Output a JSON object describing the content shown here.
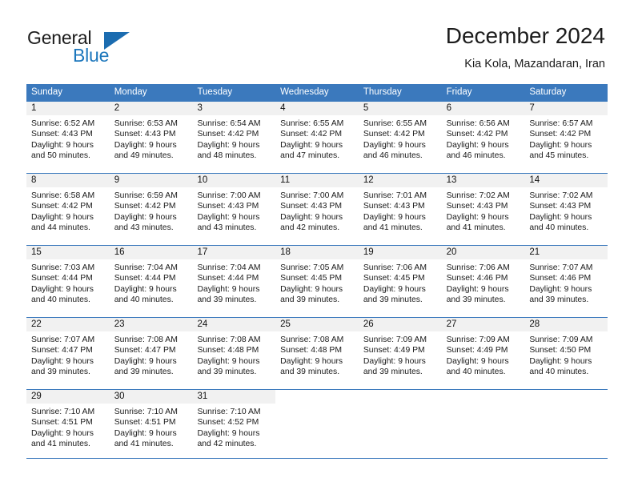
{
  "brand": {
    "name_part1": "General",
    "name_part2": "Blue",
    "flag_icon": "blue-triangle-flag-icon",
    "accent_color": "#1b76bc"
  },
  "header": {
    "month_title": "December 2024",
    "location": "Kia Kola, Mazandaran, Iran"
  },
  "theme": {
    "header_row_bg": "#3b79bd",
    "day_number_band_bg": "#f1f1f1",
    "grid_line": "#3b79bd",
    "text": "#1a1a1a"
  },
  "calendar": {
    "weekday_headers": [
      "Sunday",
      "Monday",
      "Tuesday",
      "Wednesday",
      "Thursday",
      "Friday",
      "Saturday"
    ],
    "weeks": [
      [
        {
          "day": "1",
          "sunrise": "Sunrise: 6:52 AM",
          "sunset": "Sunset: 4:43 PM",
          "daylight_line1": "Daylight: 9 hours",
          "daylight_line2": "and 50 minutes."
        },
        {
          "day": "2",
          "sunrise": "Sunrise: 6:53 AM",
          "sunset": "Sunset: 4:43 PM",
          "daylight_line1": "Daylight: 9 hours",
          "daylight_line2": "and 49 minutes."
        },
        {
          "day": "3",
          "sunrise": "Sunrise: 6:54 AM",
          "sunset": "Sunset: 4:42 PM",
          "daylight_line1": "Daylight: 9 hours",
          "daylight_line2": "and 48 minutes."
        },
        {
          "day": "4",
          "sunrise": "Sunrise: 6:55 AM",
          "sunset": "Sunset: 4:42 PM",
          "daylight_line1": "Daylight: 9 hours",
          "daylight_line2": "and 47 minutes."
        },
        {
          "day": "5",
          "sunrise": "Sunrise: 6:55 AM",
          "sunset": "Sunset: 4:42 PM",
          "daylight_line1": "Daylight: 9 hours",
          "daylight_line2": "and 46 minutes."
        },
        {
          "day": "6",
          "sunrise": "Sunrise: 6:56 AM",
          "sunset": "Sunset: 4:42 PM",
          "daylight_line1": "Daylight: 9 hours",
          "daylight_line2": "and 46 minutes."
        },
        {
          "day": "7",
          "sunrise": "Sunrise: 6:57 AM",
          "sunset": "Sunset: 4:42 PM",
          "daylight_line1": "Daylight: 9 hours",
          "daylight_line2": "and 45 minutes."
        }
      ],
      [
        {
          "day": "8",
          "sunrise": "Sunrise: 6:58 AM",
          "sunset": "Sunset: 4:42 PM",
          "daylight_line1": "Daylight: 9 hours",
          "daylight_line2": "and 44 minutes."
        },
        {
          "day": "9",
          "sunrise": "Sunrise: 6:59 AM",
          "sunset": "Sunset: 4:42 PM",
          "daylight_line1": "Daylight: 9 hours",
          "daylight_line2": "and 43 minutes."
        },
        {
          "day": "10",
          "sunrise": "Sunrise: 7:00 AM",
          "sunset": "Sunset: 4:43 PM",
          "daylight_line1": "Daylight: 9 hours",
          "daylight_line2": "and 43 minutes."
        },
        {
          "day": "11",
          "sunrise": "Sunrise: 7:00 AM",
          "sunset": "Sunset: 4:43 PM",
          "daylight_line1": "Daylight: 9 hours",
          "daylight_line2": "and 42 minutes."
        },
        {
          "day": "12",
          "sunrise": "Sunrise: 7:01 AM",
          "sunset": "Sunset: 4:43 PM",
          "daylight_line1": "Daylight: 9 hours",
          "daylight_line2": "and 41 minutes."
        },
        {
          "day": "13",
          "sunrise": "Sunrise: 7:02 AM",
          "sunset": "Sunset: 4:43 PM",
          "daylight_line1": "Daylight: 9 hours",
          "daylight_line2": "and 41 minutes."
        },
        {
          "day": "14",
          "sunrise": "Sunrise: 7:02 AM",
          "sunset": "Sunset: 4:43 PM",
          "daylight_line1": "Daylight: 9 hours",
          "daylight_line2": "and 40 minutes."
        }
      ],
      [
        {
          "day": "15",
          "sunrise": "Sunrise: 7:03 AM",
          "sunset": "Sunset: 4:44 PM",
          "daylight_line1": "Daylight: 9 hours",
          "daylight_line2": "and 40 minutes."
        },
        {
          "day": "16",
          "sunrise": "Sunrise: 7:04 AM",
          "sunset": "Sunset: 4:44 PM",
          "daylight_line1": "Daylight: 9 hours",
          "daylight_line2": "and 40 minutes."
        },
        {
          "day": "17",
          "sunrise": "Sunrise: 7:04 AM",
          "sunset": "Sunset: 4:44 PM",
          "daylight_line1": "Daylight: 9 hours",
          "daylight_line2": "and 39 minutes."
        },
        {
          "day": "18",
          "sunrise": "Sunrise: 7:05 AM",
          "sunset": "Sunset: 4:45 PM",
          "daylight_line1": "Daylight: 9 hours",
          "daylight_line2": "and 39 minutes."
        },
        {
          "day": "19",
          "sunrise": "Sunrise: 7:06 AM",
          "sunset": "Sunset: 4:45 PM",
          "daylight_line1": "Daylight: 9 hours",
          "daylight_line2": "and 39 minutes."
        },
        {
          "day": "20",
          "sunrise": "Sunrise: 7:06 AM",
          "sunset": "Sunset: 4:46 PM",
          "daylight_line1": "Daylight: 9 hours",
          "daylight_line2": "and 39 minutes."
        },
        {
          "day": "21",
          "sunrise": "Sunrise: 7:07 AM",
          "sunset": "Sunset: 4:46 PM",
          "daylight_line1": "Daylight: 9 hours",
          "daylight_line2": "and 39 minutes."
        }
      ],
      [
        {
          "day": "22",
          "sunrise": "Sunrise: 7:07 AM",
          "sunset": "Sunset: 4:47 PM",
          "daylight_line1": "Daylight: 9 hours",
          "daylight_line2": "and 39 minutes."
        },
        {
          "day": "23",
          "sunrise": "Sunrise: 7:08 AM",
          "sunset": "Sunset: 4:47 PM",
          "daylight_line1": "Daylight: 9 hours",
          "daylight_line2": "and 39 minutes."
        },
        {
          "day": "24",
          "sunrise": "Sunrise: 7:08 AM",
          "sunset": "Sunset: 4:48 PM",
          "daylight_line1": "Daylight: 9 hours",
          "daylight_line2": "and 39 minutes."
        },
        {
          "day": "25",
          "sunrise": "Sunrise: 7:08 AM",
          "sunset": "Sunset: 4:48 PM",
          "daylight_line1": "Daylight: 9 hours",
          "daylight_line2": "and 39 minutes."
        },
        {
          "day": "26",
          "sunrise": "Sunrise: 7:09 AM",
          "sunset": "Sunset: 4:49 PM",
          "daylight_line1": "Daylight: 9 hours",
          "daylight_line2": "and 39 minutes."
        },
        {
          "day": "27",
          "sunrise": "Sunrise: 7:09 AM",
          "sunset": "Sunset: 4:49 PM",
          "daylight_line1": "Daylight: 9 hours",
          "daylight_line2": "and 40 minutes."
        },
        {
          "day": "28",
          "sunrise": "Sunrise: 7:09 AM",
          "sunset": "Sunset: 4:50 PM",
          "daylight_line1": "Daylight: 9 hours",
          "daylight_line2": "and 40 minutes."
        }
      ],
      [
        {
          "day": "29",
          "sunrise": "Sunrise: 7:10 AM",
          "sunset": "Sunset: 4:51 PM",
          "daylight_line1": "Daylight: 9 hours",
          "daylight_line2": "and 41 minutes."
        },
        {
          "day": "30",
          "sunrise": "Sunrise: 7:10 AM",
          "sunset": "Sunset: 4:51 PM",
          "daylight_line1": "Daylight: 9 hours",
          "daylight_line2": "and 41 minutes."
        },
        {
          "day": "31",
          "sunrise": "Sunrise: 7:10 AM",
          "sunset": "Sunset: 4:52 PM",
          "daylight_line1": "Daylight: 9 hours",
          "daylight_line2": "and 42 minutes."
        },
        {
          "day": "",
          "sunrise": "",
          "sunset": "",
          "daylight_line1": "",
          "daylight_line2": ""
        },
        {
          "day": "",
          "sunrise": "",
          "sunset": "",
          "daylight_line1": "",
          "daylight_line2": ""
        },
        {
          "day": "",
          "sunrise": "",
          "sunset": "",
          "daylight_line1": "",
          "daylight_line2": ""
        },
        {
          "day": "",
          "sunrise": "",
          "sunset": "",
          "daylight_line1": "",
          "daylight_line2": ""
        }
      ]
    ]
  }
}
